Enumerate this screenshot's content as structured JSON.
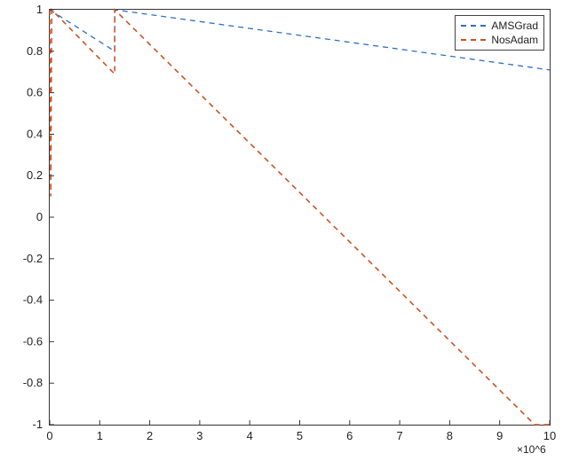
{
  "chart_data": {
    "type": "line",
    "title": "",
    "xlabel": "",
    "ylabel": "",
    "xlim": [
      0,
      10
    ],
    "ylim": [
      -1,
      1
    ],
    "x_exponent_label": "×10^6",
    "x_ticks": [
      0,
      1,
      2,
      3,
      4,
      5,
      6,
      7,
      8,
      9,
      10
    ],
    "y_ticks": [
      -1,
      -0.8,
      -0.6,
      -0.4,
      -0.2,
      0,
      0.2,
      0.4,
      0.6,
      0.8,
      1
    ],
    "series": [
      {
        "name": "AMSGrad",
        "color": "#2b6fc7",
        "dash": "6,5",
        "width": 1.3,
        "points": [
          [
            0.0,
            1.0
          ],
          [
            1.3,
            0.8
          ],
          [
            1.3,
            1.0
          ],
          [
            10.0,
            0.71
          ]
        ]
      },
      {
        "name": "NosAdam",
        "color": "#cc5222",
        "dash": "6,5",
        "width": 1.6,
        "points": [
          [
            0.0,
            1.0
          ],
          [
            0.02,
            0.1
          ],
          [
            0.04,
            1.0
          ],
          [
            1.3,
            0.69
          ],
          [
            1.3,
            1.0
          ],
          [
            9.7,
            -1.0
          ],
          [
            10.0,
            -1.0
          ]
        ]
      }
    ],
    "legend": [
      "AMSGrad",
      "NosAdam"
    ]
  }
}
